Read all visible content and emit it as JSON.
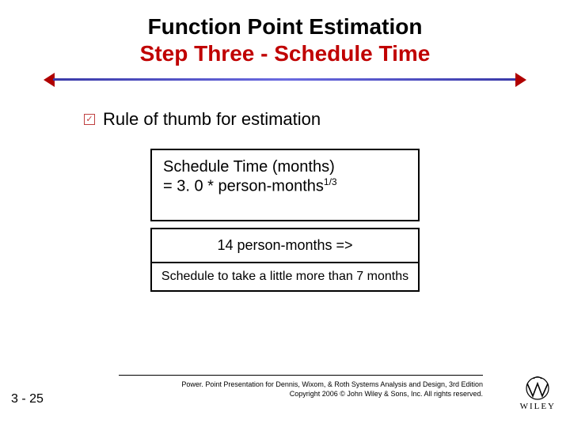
{
  "title": {
    "main": "Function Point Estimation",
    "sub": "Step Three - Schedule Time"
  },
  "bullet": {
    "icon_glyph": "✓",
    "text": "Rule of thumb for estimation"
  },
  "formula": {
    "line1": "Schedule Time (months)",
    "line2_prefix": "= 3. 0 * person-months",
    "line2_exp": "1/3"
  },
  "example": {
    "input": "14 person-months =>",
    "result": "Schedule to take a little more than 7 months"
  },
  "footer": {
    "page": "3 - 25",
    "line1": "Power. Point Presentation for Dennis, Wixom, & Roth Systems Analysis and Design, 3rd Edition",
    "line2": "Copyright 2006 © John Wiley & Sons, Inc. All rights reserved.",
    "logo_label": "WILEY"
  }
}
